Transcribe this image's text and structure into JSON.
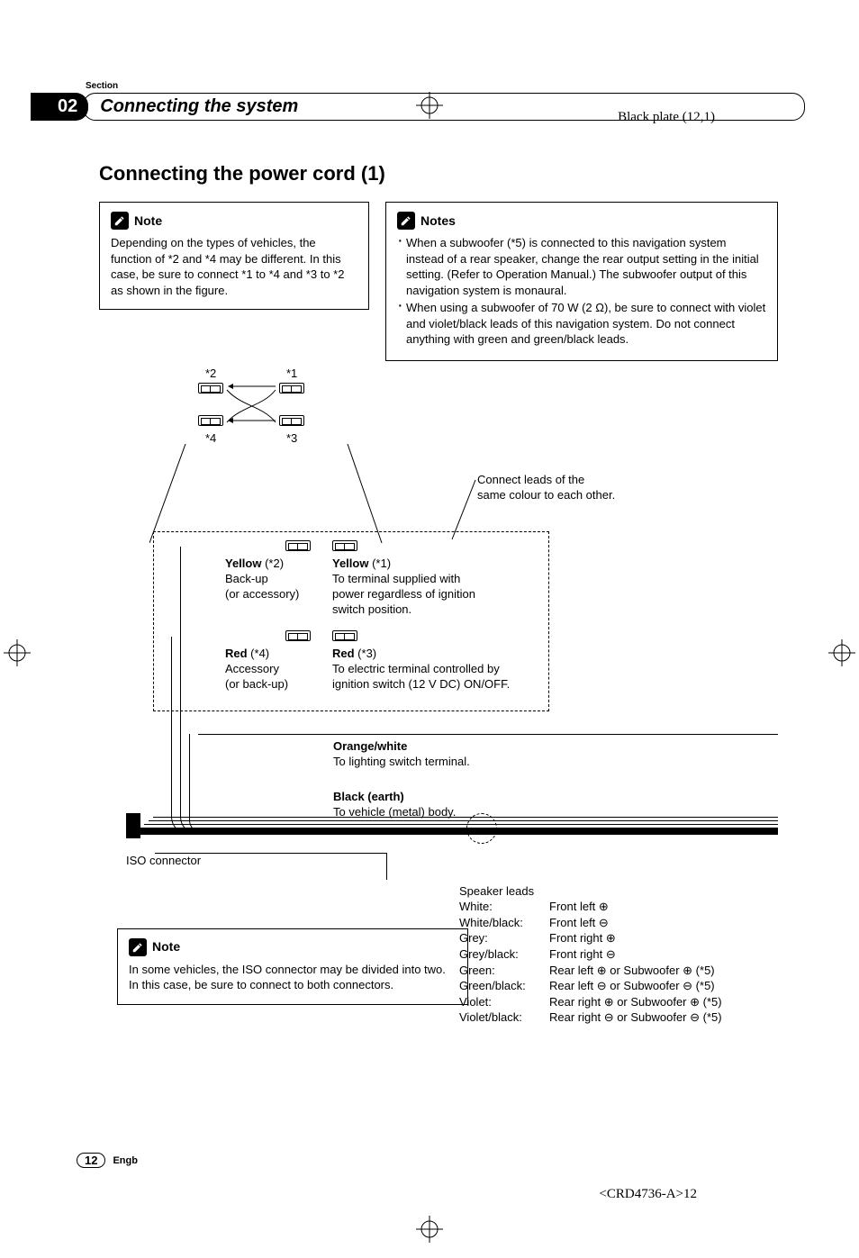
{
  "meta": {
    "black_plate": "Black plate (12,1)",
    "doc_id": "<CRD4736-A>12"
  },
  "header": {
    "section_label": "Section",
    "section_num": "02",
    "section_title": "Connecting the system"
  },
  "title": "Connecting the power cord (1)",
  "notes": {
    "note_label": "Note",
    "notes_label": "Notes",
    "top_left": "Depending on the types of vehicles, the function of *2 and *4 may be different. In this case, be sure to connect *1 to *4 and *3 to *2 as shown in the figure.",
    "top_right_1": "When a subwoofer (*5) is connected to this navigation system instead of a rear speaker, change the rear output setting in the initial setting. (Refer to Operation Manual.) The subwoofer output of this navigation system is monaural.",
    "top_right_2": "When using a subwoofer of 70 W (2 Ω), be sure to connect with violet and violet/black leads of this navigation system. Do not connect anything with green and green/black leads.",
    "lower": "In some vehicles, the ISO connector may be divided into two. In this case, be sure to connect to both connectors."
  },
  "diagram": {
    "mini": {
      "l1": "*2",
      "l2": "*1",
      "l3": "*4",
      "l4": "*3"
    },
    "lead_note_l1": "Connect leads of the",
    "lead_note_l2": "same colour to each other.",
    "yellow2_head": "Yellow",
    "yellow2_ref": " (*2)",
    "yellow2_l1": "Back-up",
    "yellow2_l2": "(or accessory)",
    "yellow1_head": "Yellow",
    "yellow1_ref": " (*1)",
    "yellow1_l1": "To terminal supplied with",
    "yellow1_l2": "power regardless of ignition",
    "yellow1_l3": "switch position.",
    "red4_head": "Red",
    "red4_ref": " (*4)",
    "red4_l1": "Accessory",
    "red4_l2": "(or back-up)",
    "red3_head": "Red",
    "red3_ref": " (*3)",
    "red3_l1": "To electric terminal controlled by",
    "red3_l2": "ignition switch (12 V DC) ON/OFF.",
    "ow_head": "Orange/white",
    "ow_l1": "To lighting switch terminal.",
    "blk_head": "Black (earth)",
    "blk_l1": "To vehicle (metal) body.",
    "iso_label": "ISO connector",
    "spk_head": "Speaker leads",
    "spk": [
      {
        "c": "White:",
        "v": "Front left ⊕"
      },
      {
        "c": "White/black:",
        "v": "Front left ⊖"
      },
      {
        "c": "Grey:",
        "v": "Front right ⊕"
      },
      {
        "c": "Grey/black:",
        "v": "Front right ⊖"
      },
      {
        "c": "Green:",
        "v": "Rear left ⊕ or Subwoofer ⊕ (*5)"
      },
      {
        "c": "Green/black:",
        "v": "Rear left ⊖ or Subwoofer ⊖ (*5)"
      },
      {
        "c": "Violet:",
        "v": "Rear right ⊕ or Subwoofer ⊕ (*5)"
      },
      {
        "c": "Violet/black:",
        "v": "Rear right ⊖ or Subwoofer ⊖ (*5)"
      }
    ]
  },
  "footer": {
    "page_num": "12",
    "lang": "Engb"
  }
}
